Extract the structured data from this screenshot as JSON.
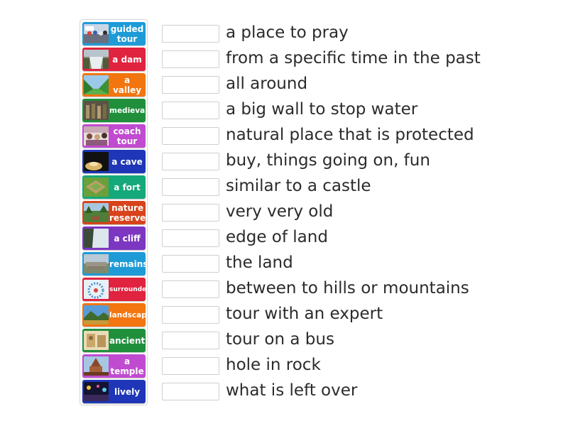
{
  "tiles": [
    {
      "label": "guided tour",
      "color": "#1e9bd7",
      "icon": "tour-group-photo"
    },
    {
      "label": "a dam",
      "color": "#e0233e",
      "icon": "dam-photo"
    },
    {
      "label": "a valley",
      "color": "#f2750f",
      "icon": "valley-photo"
    },
    {
      "label": "medieval",
      "color": "#1f8f3c",
      "icon": "medieval-photo"
    },
    {
      "label": "coach tour",
      "color": "#c04bd0",
      "icon": "coach-tour-photo"
    },
    {
      "label": "a cave",
      "color": "#1e36b7",
      "icon": "cave-photo"
    },
    {
      "label": "a fort",
      "color": "#15a87a",
      "icon": "fort-photo"
    },
    {
      "label": "nature reserve",
      "color": "#d8431b",
      "icon": "nature-reserve-photo"
    },
    {
      "label": "a cliff",
      "color": "#7d36c2",
      "icon": "cliff-photo"
    },
    {
      "label": "remains",
      "color": "#1e9bd7",
      "icon": "remains-photo"
    },
    {
      "label": "surrounded",
      "color": "#e0233e",
      "icon": "surrounded-photo"
    },
    {
      "label": "landscape",
      "color": "#f2750f",
      "icon": "landscape-photo"
    },
    {
      "label": "ancient",
      "color": "#1f8f3c",
      "icon": "ancient-photo"
    },
    {
      "label": "a temple",
      "color": "#c04bd0",
      "icon": "temple-photo"
    },
    {
      "label": "lively",
      "color": "#1e36b7",
      "icon": "lively-photo"
    }
  ],
  "clues": [
    "a place to pray",
    "from a specific time in the past",
    "all around",
    "a big wall to stop water",
    "natural place that is protected",
    "buy, things going on, fun",
    "similar to a castle",
    "very very old",
    "edge of land",
    "the land",
    "between to hills or mountains",
    "tour with an expert",
    "tour on a bus",
    "hole in rock",
    "what is left over"
  ]
}
